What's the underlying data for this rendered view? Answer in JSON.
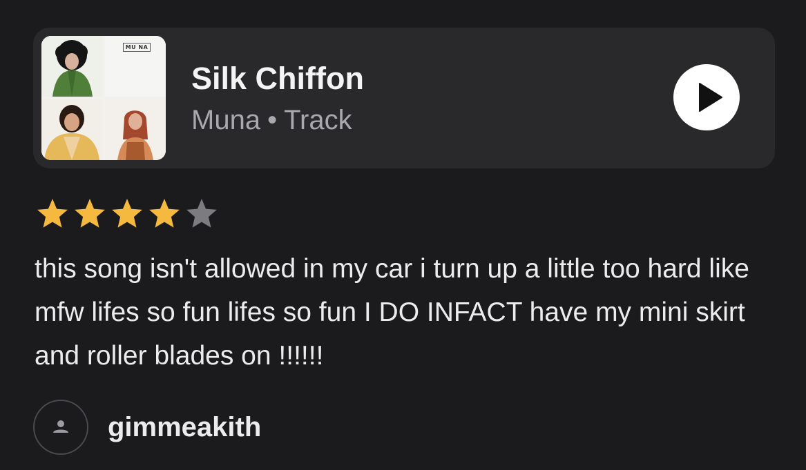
{
  "track": {
    "title": "Silk Chiffon",
    "artist": "Muna",
    "separator": "•",
    "type": "Track",
    "cover_logo_text": "MU NA",
    "play_icon": "play-icon"
  },
  "rating": {
    "value": 4,
    "max": 5,
    "filled_color": "#f4b93e",
    "empty_color": "#7c7c80"
  },
  "review": {
    "text": "this song isn't allowed in my car i turn up a little too hard like mfw lifes so fun lifes so fun I DO INFACT have my mini skirt and roller blades on !!!!!!"
  },
  "author": {
    "username": "gimmeakith",
    "avatar_icon": "user-avatar-icon"
  },
  "colors": {
    "background": "#1b1b1d",
    "card": "#29292c",
    "text_primary": "#f4f4f4",
    "text_secondary": "#a9a9ad"
  }
}
